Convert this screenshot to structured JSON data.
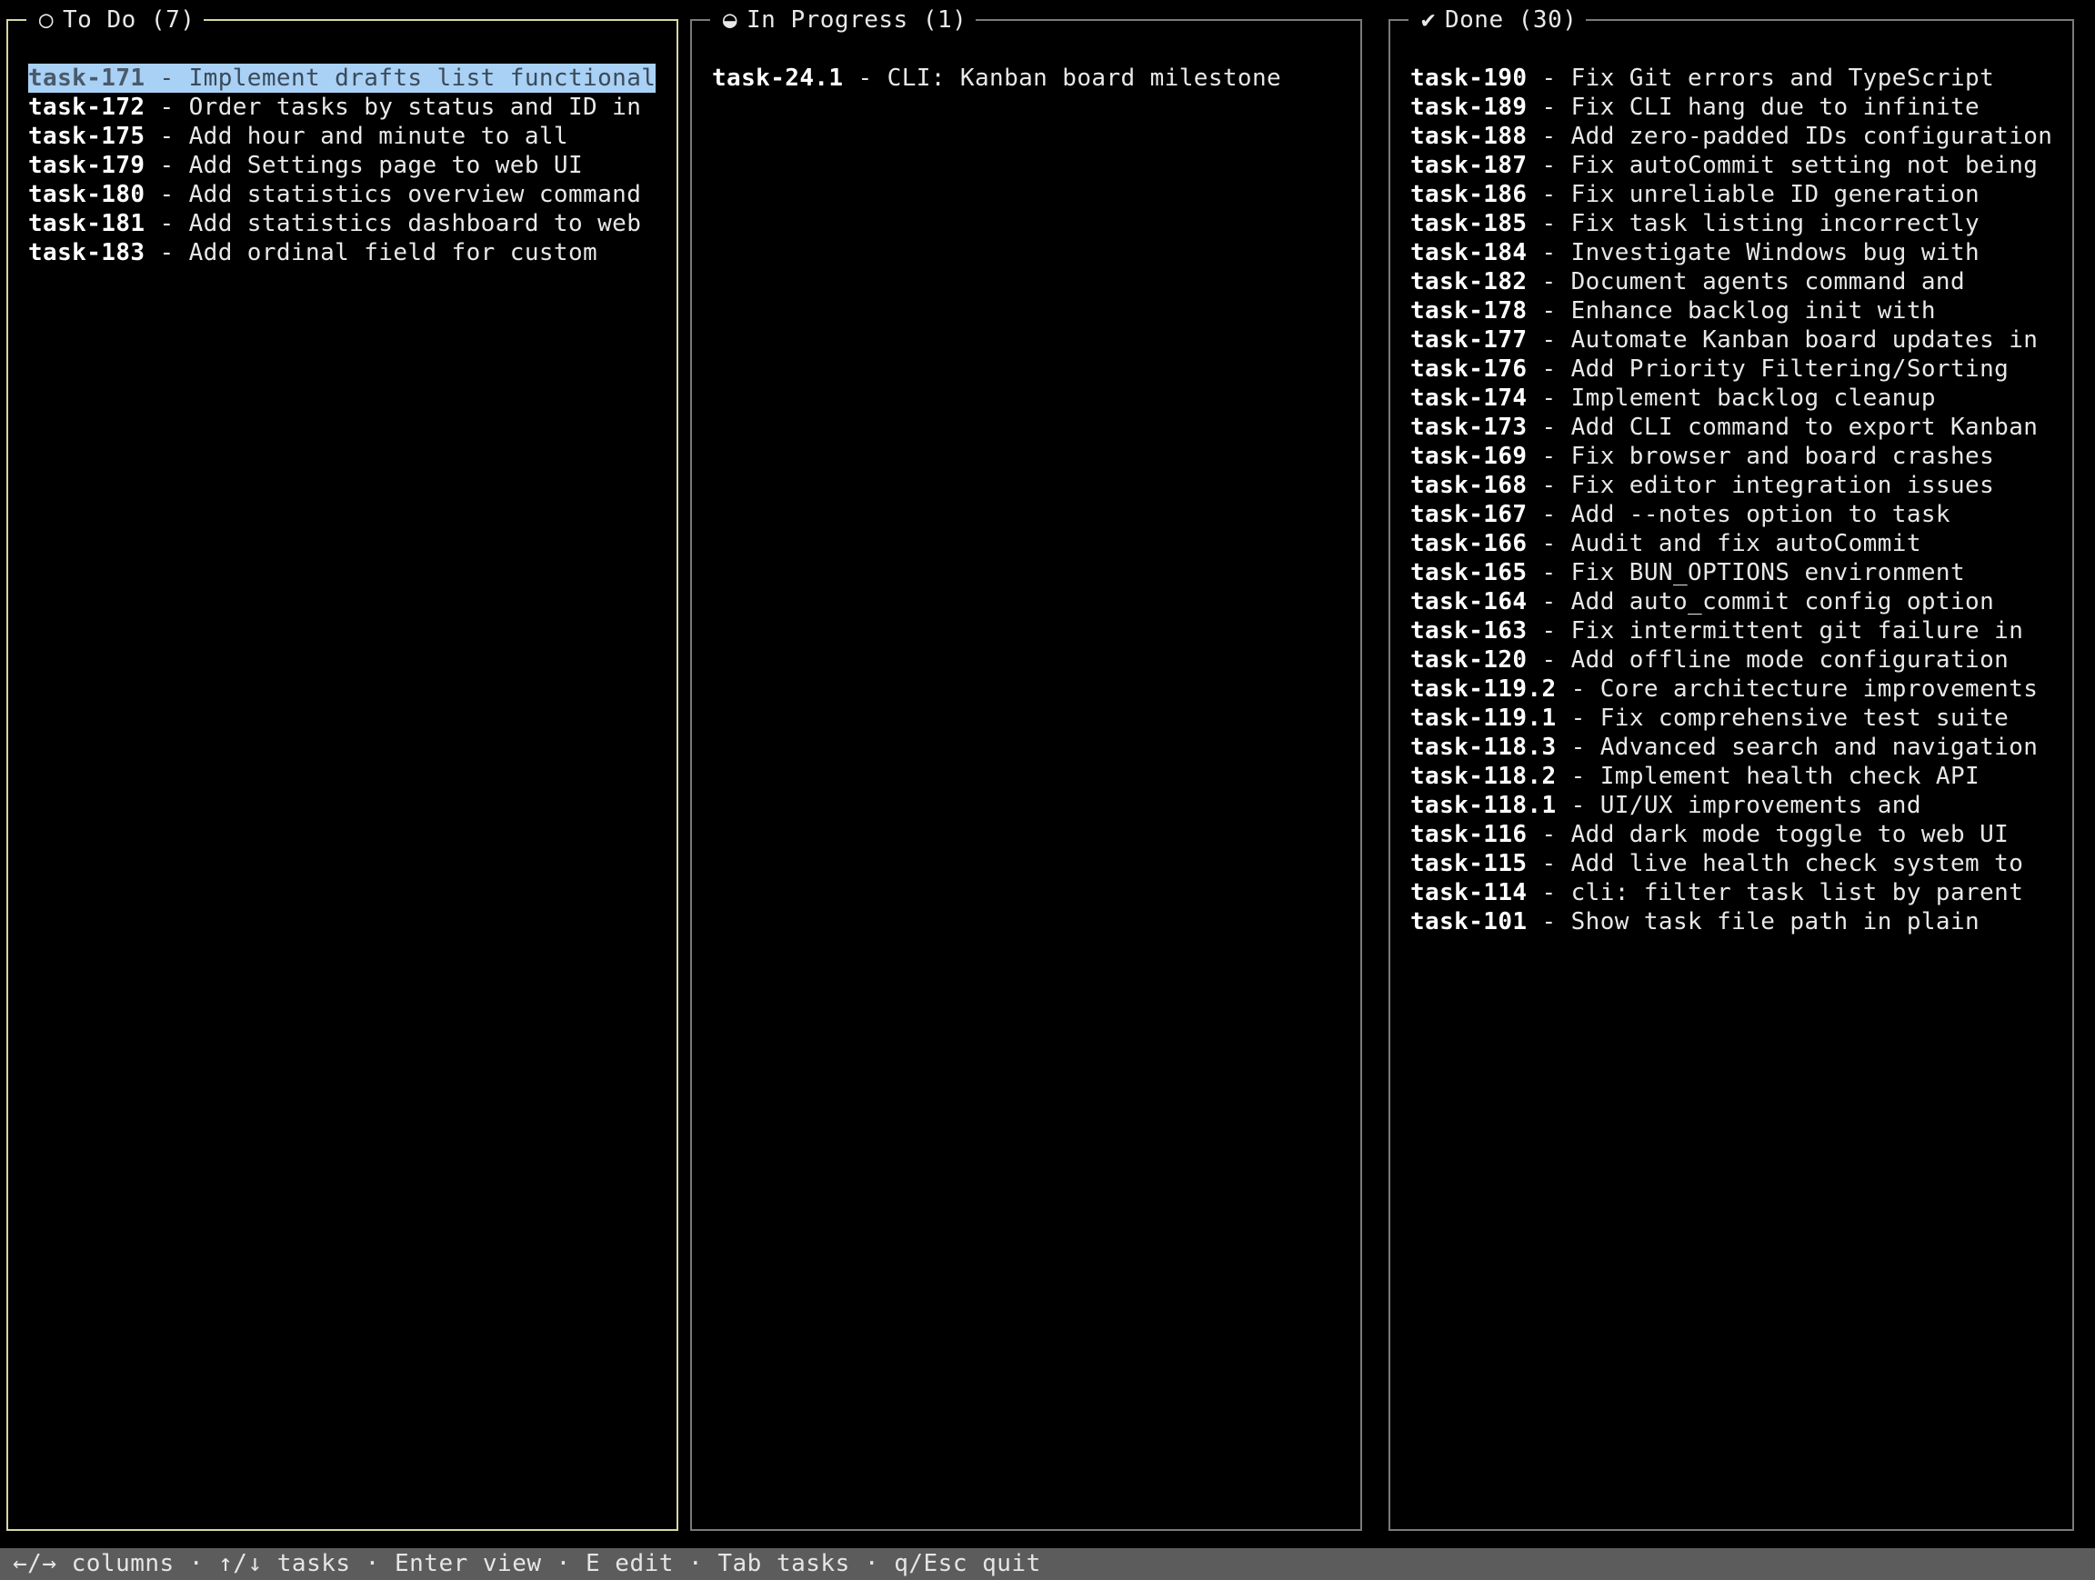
{
  "columns": [
    {
      "id": "todo",
      "glyph": "○",
      "title": "To Do (7)",
      "tasks": [
        {
          "id": "task-171",
          "title": " - Implement drafts list functional"
        },
        {
          "id": "task-172",
          "title": " - Order tasks by status and ID in"
        },
        {
          "id": "task-175",
          "title": " - Add hour and minute to all"
        },
        {
          "id": "task-179",
          "title": " - Add Settings page to web UI"
        },
        {
          "id": "task-180",
          "title": " - Add statistics overview command"
        },
        {
          "id": "task-181",
          "title": " - Add statistics dashboard to web"
        },
        {
          "id": "task-183",
          "title": " - Add ordinal field for custom"
        }
      ]
    },
    {
      "id": "progress",
      "glyph": "◒",
      "title": "In Progress (1)",
      "tasks": [
        {
          "id": "task-24.1",
          "title": " - CLI: Kanban board milestone"
        }
      ]
    },
    {
      "id": "done",
      "glyph": "✔",
      "title": "Done (30)",
      "tasks": [
        {
          "id": "task-190",
          "title": " - Fix Git errors and TypeScript"
        },
        {
          "id": "task-189",
          "title": " - Fix CLI hang due to infinite"
        },
        {
          "id": "task-188",
          "title": " - Add zero-padded IDs configuration"
        },
        {
          "id": "task-187",
          "title": " - Fix autoCommit setting not being"
        },
        {
          "id": "task-186",
          "title": " - Fix unreliable ID generation"
        },
        {
          "id": "task-185",
          "title": " - Fix task listing incorrectly"
        },
        {
          "id": "task-184",
          "title": " - Investigate Windows bug with"
        },
        {
          "id": "task-182",
          "title": " - Document agents command and"
        },
        {
          "id": "task-178",
          "title": " - Enhance backlog init with"
        },
        {
          "id": "task-177",
          "title": " - Automate Kanban board updates in"
        },
        {
          "id": "task-176",
          "title": " - Add Priority Filtering/Sorting"
        },
        {
          "id": "task-174",
          "title": " - Implement backlog cleanup"
        },
        {
          "id": "task-173",
          "title": " - Add CLI command to export Kanban"
        },
        {
          "id": "task-169",
          "title": " - Fix browser and board crashes"
        },
        {
          "id": "task-168",
          "title": " - Fix editor integration issues"
        },
        {
          "id": "task-167",
          "title": " - Add --notes option to task"
        },
        {
          "id": "task-166",
          "title": " - Audit and fix autoCommit"
        },
        {
          "id": "task-165",
          "title": " - Fix BUN_OPTIONS environment"
        },
        {
          "id": "task-164",
          "title": " - Add auto_commit config option"
        },
        {
          "id": "task-163",
          "title": " - Fix intermittent git failure in"
        },
        {
          "id": "task-120",
          "title": " - Add offline mode configuration"
        },
        {
          "id": "task-119.2",
          "title": " - Core architecture improvements"
        },
        {
          "id": "task-119.1",
          "title": " - Fix comprehensive test suite"
        },
        {
          "id": "task-118.3",
          "title": " - Advanced search and navigation"
        },
        {
          "id": "task-118.2",
          "title": " - Implement health check API"
        },
        {
          "id": "task-118.1",
          "title": " - UI/UX improvements and"
        },
        {
          "id": "task-116",
          "title": " - Add dark mode toggle to web UI"
        },
        {
          "id": "task-115",
          "title": " - Add live health check system to"
        },
        {
          "id": "task-114",
          "title": " - cli: filter task list by parent"
        },
        {
          "id": "task-101",
          "title": " - Show task file path in plain"
        }
      ]
    }
  ],
  "selection": {
    "column": "todo",
    "task": "task-171"
  },
  "status_bar": {
    "text": "←/→ columns · ↑/↓ tasks · Enter view · E edit · Tab tasks · q/Esc quit"
  },
  "colors": {
    "background": "#000000",
    "active_border": "#d8d8a0",
    "inactive_border": "#7a7a7a",
    "selection_bg": "#a9d1f5",
    "status_bar_bg": "#5c5c5c"
  }
}
